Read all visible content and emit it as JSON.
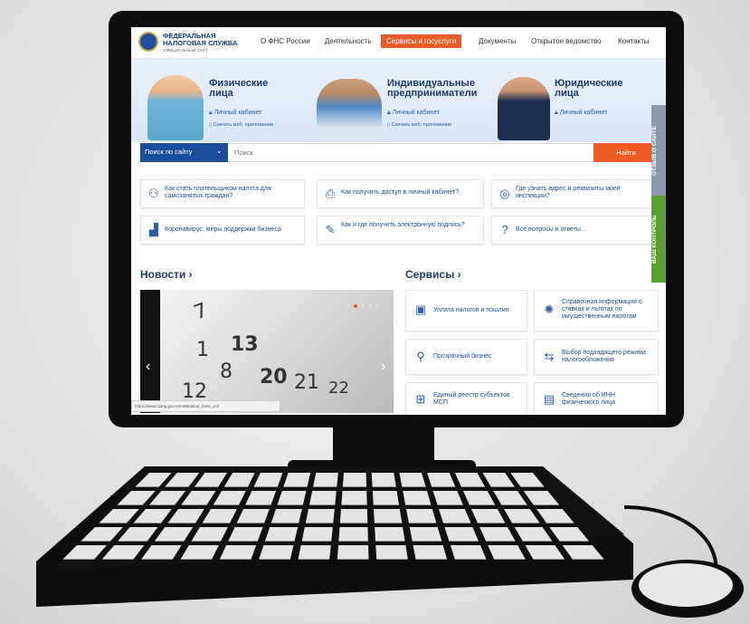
{
  "header": {
    "logo_line1": "ФЕДЕРАЛЬНАЯ",
    "logo_line2": "НАЛОГОВАЯ СЛУЖБА",
    "logo_sub": "ОФИЦИАЛЬНЫЙ САЙТ",
    "nav": [
      "О ФНС России",
      "Деятельность",
      "Сервисы и госуслуги",
      "Документы",
      "Открытое ведомство",
      "Контакты"
    ],
    "active_nav": "Сервисы и госуслуги"
  },
  "hero": {
    "categories": [
      {
        "title1": "Физические",
        "title2": "лица",
        "link": "Личный кабинет",
        "sub": "Скачать моб. приложение"
      },
      {
        "title1": "Индивидуальные",
        "title2": "предприниматели",
        "link": "Личный кабинет",
        "sub": "Скачать моб. приложение"
      },
      {
        "title1": "Юридические",
        "title2": "лица",
        "link": "Личный кабинет",
        "sub": ""
      }
    ]
  },
  "search": {
    "scope_label": "Поиск по сайту",
    "placeholder": "Поиск",
    "button_label": "Найти"
  },
  "quick_links": [
    {
      "text": "Как стать плательщиком налога для самозанятых граждан?",
      "icon": "people-icon"
    },
    {
      "text": "Как получить доступ в личный кабинет?",
      "icon": "cabinet-icon"
    },
    {
      "text": "Где узнать адрес и реквизиты моей инспекции?",
      "icon": "emblem-icon"
    },
    {
      "text": "Коронавирус: меры поддержки бизнеса",
      "icon": "chart-icon"
    },
    {
      "text": "Как и где получить электронную подпись?",
      "icon": "signature-icon"
    },
    {
      "text": "Все вопросы и ответы...",
      "icon": "question-icon"
    }
  ],
  "news": {
    "title": "Новости ›",
    "calendar_numbers": [
      "7",
      "13",
      "20",
      "21",
      "12",
      "8",
      "22",
      "1"
    ],
    "status_url": "https://www.nalog.gov.ru/rn69/about_fts/el_usl/"
  },
  "services": {
    "title": "Сервисы ›",
    "items": [
      {
        "text": "Уплата налогов и пошлин",
        "icon": "payment-icon"
      },
      {
        "text": "Справочная информация о ставках и льготах по имущественным налогам",
        "icon": "reference-icon"
      },
      {
        "text": "Прозрачный бизнес",
        "icon": "transparent-business-icon"
      },
      {
        "text": "Выбор подходящего режима налогообложения",
        "icon": "tax-regime-icon"
      },
      {
        "text": "Единый реестр субъектов МСП",
        "icon": "registry-icon"
      },
      {
        "text": "Сведения об ИНН физического лица",
        "icon": "inn-icon"
      }
    ]
  },
  "side_tabs": {
    "feedback": "ОТЗЫВ О САЙТЕ",
    "control": "ВАШ КОНТРОЛЬ"
  },
  "colors": {
    "accent": "#ee5b24",
    "brand": "#1a4d9a",
    "control_tab": "#5a9e34",
    "feedback_tab": "#8a9aab"
  }
}
